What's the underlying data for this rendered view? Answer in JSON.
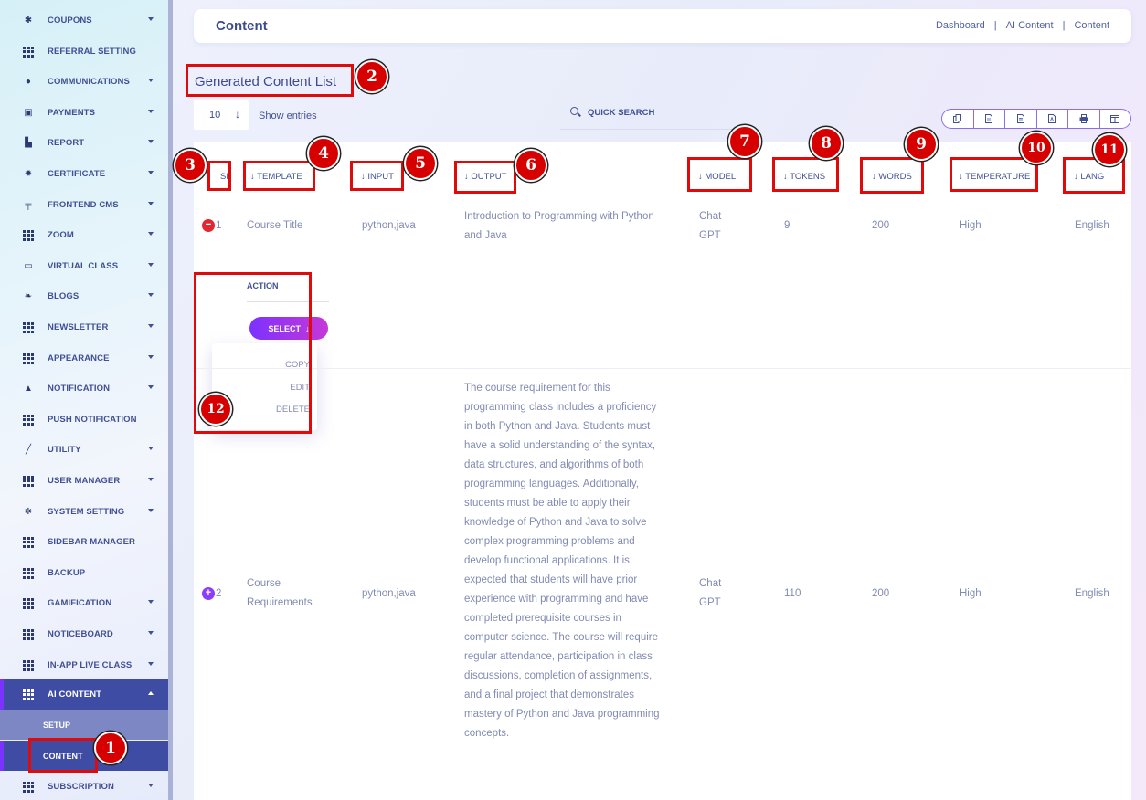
{
  "sidebar": {
    "items": [
      {
        "label": "COUPONS",
        "icon": "coupon-icon",
        "caret": true
      },
      {
        "label": "REFERRAL SETTING",
        "icon": "grid-icon",
        "caret": false
      },
      {
        "label": "COMMUNICATIONS",
        "icon": "chat-icon",
        "caret": true
      },
      {
        "label": "PAYMENTS",
        "icon": "money-icon",
        "caret": true
      },
      {
        "label": "REPORT",
        "icon": "chart-icon",
        "caret": true
      },
      {
        "label": "CERTIFICATE",
        "icon": "certificate-icon",
        "caret": true
      },
      {
        "label": "FRONTEND CMS",
        "icon": "paint-roller-icon",
        "caret": true
      },
      {
        "label": "ZOOM",
        "icon": "grid-icon",
        "caret": true
      },
      {
        "label": "VIRTUAL CLASS",
        "icon": "vr-icon",
        "caret": true
      },
      {
        "label": "BLOGS",
        "icon": "blog-icon",
        "caret": true
      },
      {
        "label": "NEWSLETTER",
        "icon": "grid-icon",
        "caret": true
      },
      {
        "label": "APPEARANCE",
        "icon": "grid-icon",
        "caret": true
      },
      {
        "label": "NOTIFICATION",
        "icon": "bell-icon",
        "caret": true
      },
      {
        "label": "PUSH NOTIFICATION",
        "icon": "grid-icon",
        "caret": false
      },
      {
        "label": "UTILITY",
        "icon": "hammer-icon",
        "caret": true
      },
      {
        "label": "USER MANAGER",
        "icon": "grid-icon",
        "caret": true
      },
      {
        "label": "SYSTEM SETTING",
        "icon": "gears-icon",
        "caret": true
      },
      {
        "label": "SIDEBAR MANAGER",
        "icon": "grid-icon",
        "caret": false
      },
      {
        "label": "BACKUP",
        "icon": "grid-icon",
        "caret": false
      },
      {
        "label": "GAMIFICATION",
        "icon": "grid-icon",
        "caret": true
      },
      {
        "label": "NOTICEBOARD",
        "icon": "grid-icon",
        "caret": true
      },
      {
        "label": "IN-APP LIVE CLASS",
        "icon": "grid-icon",
        "caret": true
      }
    ],
    "active": {
      "label": "AI CONTENT",
      "icon": "grid-icon"
    },
    "sub_items": {
      "setup": "SETUP",
      "content": "CONTENT"
    },
    "after": {
      "label": "SUBSCRIPTION",
      "icon": "grid-icon"
    }
  },
  "header": {
    "title": "Content",
    "breadcrumb": [
      "Dashboard",
      "AI Content",
      "Content"
    ],
    "separator": "|"
  },
  "list": {
    "title": "Generated Content List",
    "entries_value": "10",
    "entries_arrow": "↓",
    "show_entries": "Show entries",
    "search_placeholder": "QUICK SEARCH",
    "export_icons": [
      "copy-icon",
      "csv-icon",
      "excel-icon",
      "pdf-icon",
      "print-icon",
      "columns-icon"
    ]
  },
  "table": {
    "columns": {
      "sl": "SL",
      "template": "↓ TEMPLATE",
      "input": "↓ INPUT",
      "output": "↓ OUTPUT",
      "model": "↓ MODEL",
      "tokens": "↓ TOKENS",
      "words": "↓ WORDS",
      "temperature": "↓ TEMPERATURE",
      "lang": "↓ LANG"
    },
    "rows": [
      {
        "sl": "1",
        "toggle": "−",
        "template": "Course Title",
        "input": "python,java",
        "output": "Introduction to Programming with Python and Java",
        "model": "Chat GPT",
        "tokens": "9",
        "words": "200",
        "temperature": "High",
        "lang": "English"
      },
      {
        "sl": "2",
        "toggle": "+",
        "template": "Course Requirements",
        "input": "python,java",
        "output": "The course requirement for this programming class includes a proficiency in both Python and Java. Students must have a solid understanding of the syntax, data structures, and algorithms of both programming languages. Additionally, students must be able to apply their knowledge of Python and Java to solve complex programming problems and develop functional applications. It is expected that students will have prior experience with programming and have completed prerequisite courses in computer science. The course will require regular attendance, participation in class discussions, completion of assignments, and a final project that demonstrates mastery of Python and Java programming concepts.",
        "model": "Chat GPT",
        "tokens": "110",
        "words": "200",
        "temperature": "High",
        "lang": "English"
      }
    ],
    "action": {
      "label": "ACTION",
      "select": "SELECT",
      "select_arrow": "↓",
      "menu": [
        "COPY",
        "EDIT",
        "DELETE"
      ]
    }
  },
  "annotations": [
    "1",
    "2",
    "3",
    "4",
    "5",
    "6",
    "7",
    "8",
    "9",
    "10",
    "11",
    "12"
  ],
  "colors": {
    "primary": "#415094",
    "active_bg": "#3f4ca3",
    "accent_purple": "#7c32ff",
    "annotation_red": "#e10a0a"
  }
}
